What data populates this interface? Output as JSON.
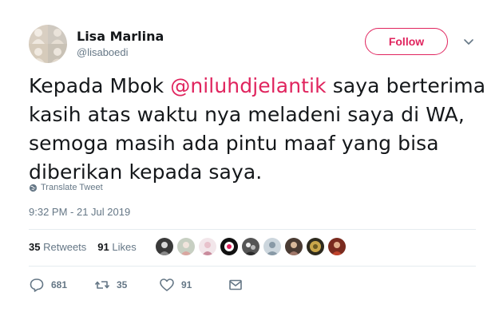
{
  "author": {
    "name": "Lisa Marlina",
    "handle": "@lisaboedi"
  },
  "follow_label": "Follow",
  "tweet": {
    "text_before": "Kepada Mbok ",
    "mention": "@niluhdjelantik",
    "text_after": " saya berterima kasih atas waktu nya meladeni saya di WA, semoga masih ada pintu maaf yang bisa diberikan kepada saya."
  },
  "translate_label": "Translate Tweet",
  "timestamp": "9:32 PM - 21 Jul 2019",
  "stats": {
    "retweets_count": "35",
    "retweets_label": "Retweets",
    "likes_count": "91",
    "likes_label": "Likes"
  },
  "liker_avatars": [
    "avatar-1",
    "avatar-2",
    "avatar-3",
    "avatar-4",
    "avatar-5",
    "avatar-6",
    "avatar-7",
    "avatar-8",
    "avatar-9"
  ],
  "actions": {
    "reply_count": "681",
    "retweet_count": "35",
    "like_count": "91"
  },
  "colors": {
    "accent": "#e0245e",
    "muted": "#657786",
    "text": "#14171a"
  },
  "icons": [
    "caret-down-icon",
    "globe-icon",
    "reply-icon",
    "retweet-icon",
    "heart-icon",
    "envelope-icon"
  ]
}
